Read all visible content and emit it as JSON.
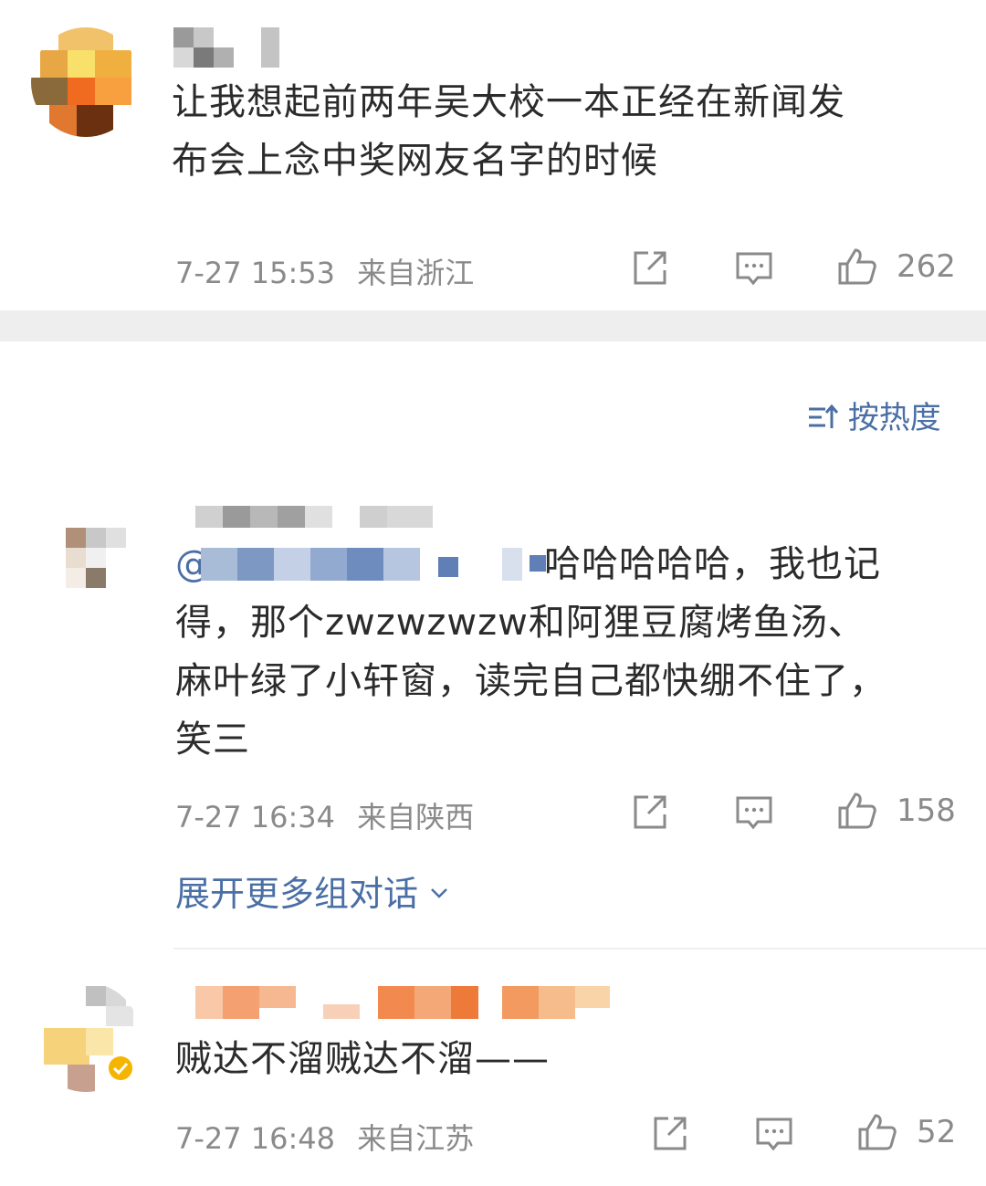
{
  "post": {
    "content": "让我想起前两年吴大校一本正经在新闻发布会上念中奖网友名字的时候",
    "content_line1": "让我想起前两年吴大校一本正经在新闻发",
    "content_line2": "布会上念中奖网友名字的时候",
    "time": "7-27 15:53",
    "location": "来自浙江",
    "likes": "262"
  },
  "sort_label": "按热度",
  "comments": [
    {
      "mention_prefix": "@",
      "text_line1_tail": "哈哈哈哈哈，我也记",
      "text_line2": "得，那个zwzwzwzw和阿狸豆腐烤鱼汤、",
      "text_line3": "麻叶绿了小轩窗，读完自己都快绷不住了，",
      "text_line4": "笑三",
      "time": "7-27 16:34",
      "location": "来自陕西",
      "likes": "158",
      "expand_label": "展开更多组对话"
    },
    {
      "text": "贼达不溜贼达不溜——",
      "time": "7-27 16:48",
      "location": "来自江苏",
      "likes": "52",
      "verified": true
    }
  ],
  "icons": {
    "share": "share-icon",
    "comment": "comment-icon",
    "like": "thumbs-up-icon",
    "sort": "sort-icon",
    "chevron": "chevron-down-icon",
    "verified": "verified-badge-icon"
  },
  "colors": {
    "link": "#4a6fa5",
    "meta": "#8a8a8a",
    "text": "#2b2b2b",
    "verified": "#f5b400"
  }
}
